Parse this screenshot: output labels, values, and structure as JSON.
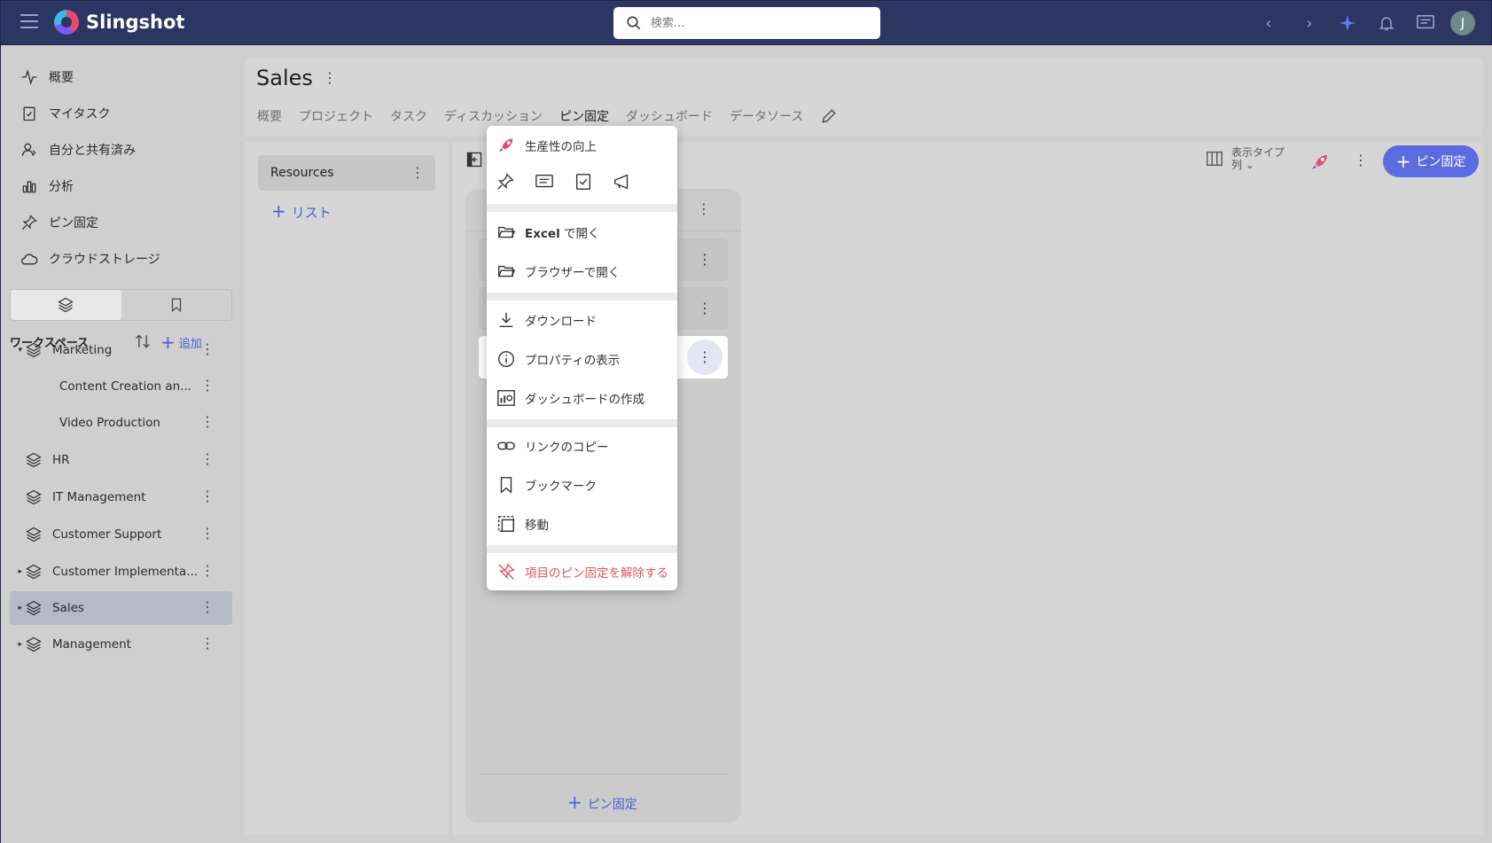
{
  "app": {
    "name": "Slingshot"
  },
  "search": {
    "placeholder": "検索..."
  },
  "user": {
    "avatar_initial": "J"
  },
  "nav": [
    {
      "label": "概要",
      "icon": "activity-icon"
    },
    {
      "label": "マイタスク",
      "icon": "clipboard-check-icon"
    },
    {
      "label": "自分と共有済み",
      "icon": "user-share-icon"
    },
    {
      "label": "分析",
      "icon": "bar-chart-icon"
    },
    {
      "label": "ピン固定",
      "icon": "pin-icon"
    },
    {
      "label": "クラウドストレージ",
      "icon": "cloud-icon"
    }
  ],
  "workspace": {
    "title": "ワークスペース",
    "add_label": "追加",
    "items": [
      {
        "label": "Marketing",
        "expanded": true,
        "child": false
      },
      {
        "label": "Content Creation an...",
        "child": true
      },
      {
        "label": "Video Production",
        "child": true
      },
      {
        "label": "HR",
        "child": false
      },
      {
        "label": "IT Management",
        "child": false
      },
      {
        "label": "Customer Support",
        "child": false
      },
      {
        "label": "Customer Implementa...",
        "child": false,
        "collapsed": true
      },
      {
        "label": "Sales",
        "child": false,
        "collapsed": true,
        "selected": true
      },
      {
        "label": "Management",
        "child": false,
        "collapsed": true
      }
    ]
  },
  "page": {
    "title": "Sales",
    "tabs": [
      {
        "label": "概要"
      },
      {
        "label": "プロジェクト"
      },
      {
        "label": "タスク"
      },
      {
        "label": "ディスカッション"
      },
      {
        "label": "ピン固定",
        "active": true
      },
      {
        "label": "ダッシュボード"
      },
      {
        "label": "データソース"
      }
    ]
  },
  "resources": {
    "item_label": "Resources",
    "add_list_label": "リスト"
  },
  "board": {
    "view_type_label": "表示タイプ",
    "view_type_value": "列",
    "pin_button_label": "ピン固定",
    "column_add_label": "ピン固定"
  },
  "context_menu": {
    "header_label": "生産性の向上",
    "quick_icons": [
      "pin-icon",
      "comment-icon",
      "task-icon",
      "announcement-icon"
    ],
    "items": [
      {
        "label_bold": "Excel",
        "label": " で開く",
        "icon": "folder-open-icon"
      },
      {
        "label": "ブラウザーで開く",
        "icon": "folder-open-icon"
      },
      {
        "label": "ダウンロード",
        "icon": "download-icon"
      },
      {
        "label": "プロパティの表示",
        "icon": "info-icon"
      },
      {
        "label": "ダッシュボードの作成",
        "icon": "dashboard-icon"
      },
      {
        "label": "リンクのコピー",
        "icon": "link-icon"
      },
      {
        "label": "ブックマーク",
        "icon": "bookmark-icon"
      },
      {
        "label": "移動",
        "icon": "move-icon"
      },
      {
        "label": "項目のピン固定を解除する",
        "icon": "unpin-icon",
        "danger": true
      }
    ]
  },
  "colors": {
    "topbar": "#2d3563",
    "accent": "#5c6be0",
    "danger": "#e25757"
  }
}
